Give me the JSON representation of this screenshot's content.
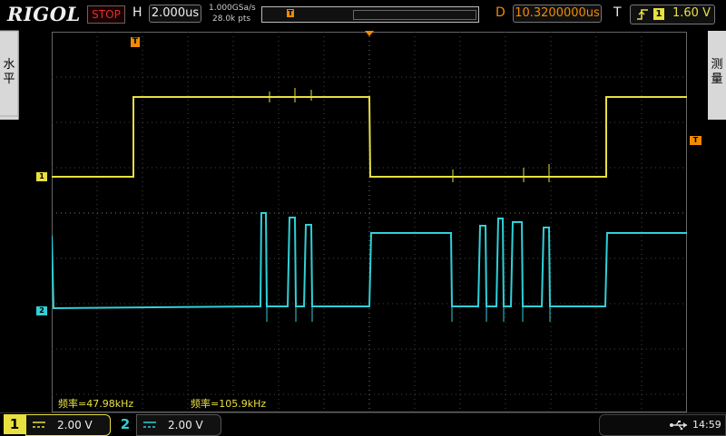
{
  "header": {
    "brand": "RIGOL",
    "run_state": "STOP",
    "horizontal_label": "H",
    "timebase": "2.000us",
    "sample_rate": "1.000GSa/s",
    "memory_depth": "28.0k pts",
    "delay_label": "D",
    "delay_value": "10.3200000us",
    "trigger_label": "T",
    "trigger_source": "1",
    "trigger_level": "1.60 V"
  },
  "side": {
    "left_tab": "水平",
    "right_tab": "测量"
  },
  "measurements": {
    "freq1": "频率=47.98kHz",
    "freq2": "频率=105.9kHz"
  },
  "channels": [
    {
      "number": "1",
      "coupling_icon": "dc-coupling-icon",
      "scale": "2.00 V",
      "color": "#e8e040"
    },
    {
      "number": "2",
      "coupling_icon": "dc-coupling-icon",
      "scale": "2.00 V",
      "color": "#30d0d8"
    }
  ],
  "markers": {
    "ch1_marker": "1",
    "ch2_marker": "2",
    "trigger_marker": "T"
  },
  "status": {
    "usb_icon": "usb-icon",
    "clock": "14:59"
  },
  "colors": {
    "ch1": "#e8e040",
    "ch2": "#30d0d8",
    "trigger": "#f08a00",
    "stop": "#e03030"
  }
}
